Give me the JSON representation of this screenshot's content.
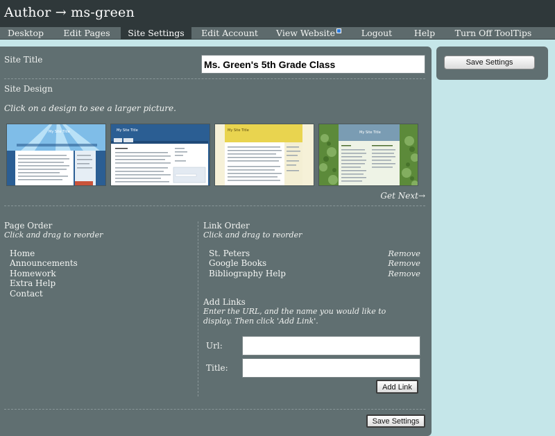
{
  "app": {
    "title": "Author → ms-green"
  },
  "nav": {
    "items": [
      {
        "label": "Desktop",
        "active": false
      },
      {
        "label": "Edit Pages",
        "active": false
      },
      {
        "label": "Site Settings",
        "active": true
      },
      {
        "label": "Edit Account",
        "active": false
      },
      {
        "label": "View Website",
        "active": false,
        "icon": "external-link-icon"
      },
      {
        "label": "Logout",
        "active": false
      },
      {
        "label": "Help",
        "active": false
      },
      {
        "label": "Turn Off ToolTips",
        "active": false
      }
    ]
  },
  "site_title": {
    "label": "Site Title",
    "value": "Ms. Green's 5th Grade Class"
  },
  "site_design": {
    "label": "Site Design",
    "instruction": "Click on a design to see a larger picture.",
    "thumbnails": [
      {
        "header_text": "My Site Title",
        "theme": "blue-sunburst"
      },
      {
        "header_text": "My Site Title",
        "theme": "blue-tabs"
      },
      {
        "header_text": "My Site Title",
        "theme": "yellow"
      },
      {
        "header_text": "My Site Title",
        "theme": "green-leaves"
      }
    ],
    "next_label": "Get Next→"
  },
  "page_order": {
    "label": "Page Order",
    "hint": "Click and drag to reorder",
    "items": [
      "Home",
      "Announcements",
      "Homework",
      "Extra Help",
      "Contact"
    ]
  },
  "link_order": {
    "label": "Link Order",
    "hint": "Click and drag to reorder",
    "items": [
      "St. Peters",
      "Google Books",
      "Bibliography Help"
    ],
    "remove_label": "Remove"
  },
  "add_links": {
    "label": "Add Links",
    "instructions_line1": "Enter the URL, and the name you would like to",
    "instructions_line2": "display. Then click 'Add Link'.",
    "url_label": "Url:",
    "url_value": "",
    "title_label": "Title:",
    "title_value": "",
    "button_label": "Add Link"
  },
  "actions": {
    "save_label": "Save Settings"
  },
  "colors": {
    "background": "#c5e6e9",
    "header": "#2f383a",
    "nav": "#5d6a6c",
    "panel": "#606f71",
    "thumb_blue": "#2b5e93",
    "thumb_yellow": "#e9d44f",
    "thumb_green": "#5c8a3a"
  }
}
